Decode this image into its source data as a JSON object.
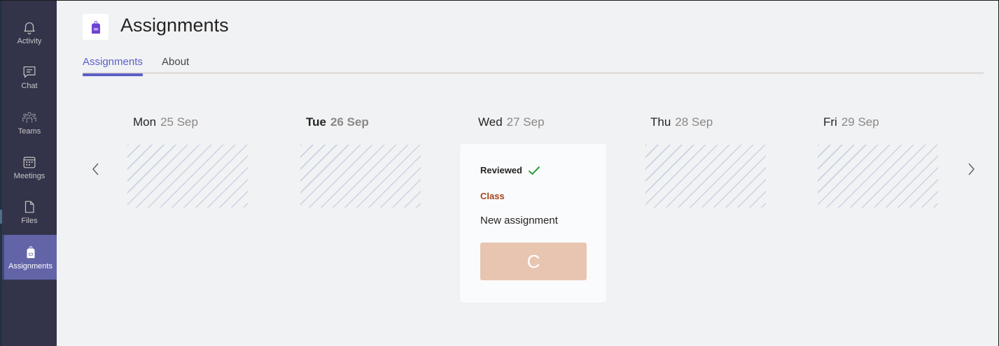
{
  "rail": {
    "items": [
      {
        "label": "Activity",
        "icon": "bell-icon"
      },
      {
        "label": "Chat",
        "icon": "chat-icon"
      },
      {
        "label": "Teams",
        "icon": "teams-icon"
      },
      {
        "label": "Meetings",
        "icon": "calendar-icon"
      },
      {
        "label": "Files",
        "icon": "file-icon"
      },
      {
        "label": "Assignments",
        "icon": "backpack-icon",
        "active": true
      }
    ]
  },
  "header": {
    "title": "Assignments",
    "logo_icon": "backpack-icon",
    "logo_color": "#6e3fd2"
  },
  "tabs": [
    {
      "label": "Assignments",
      "active": true
    },
    {
      "label": "About",
      "active": false
    }
  ],
  "days": [
    {
      "weekday": "Mon",
      "date": "25 Sep"
    },
    {
      "weekday": "Tue",
      "date": "26 Sep",
      "today": true
    },
    {
      "weekday": "Wed",
      "date": "27 Sep"
    },
    {
      "weekday": "Thu",
      "date": "28 Sep"
    },
    {
      "weekday": "Fri",
      "date": "29 Sep"
    }
  ],
  "card": {
    "status": "Reviewed",
    "status_icon": "checkmark-icon",
    "class_name": "Class",
    "title": "New assignment",
    "grade": "C"
  },
  "colors": {
    "accent": "#5b5fc7",
    "rail_bg": "#33344a",
    "rail_active": "#6264a7",
    "class_color": "#a4451b",
    "grade_bg": "#e8c5b0",
    "check_color": "#2e9e3b"
  }
}
